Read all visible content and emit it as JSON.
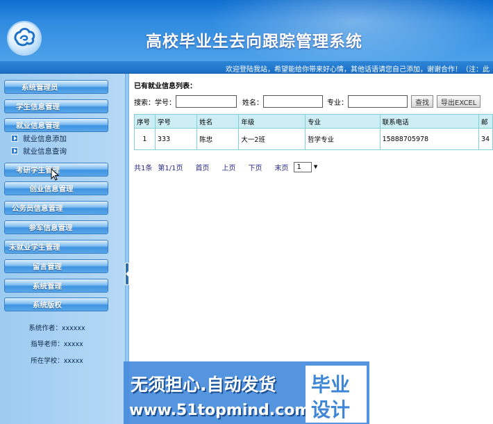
{
  "app": {
    "title": "高校毕业生去向跟踪管理系统",
    "marquee": "欢迎登陆我站，希望能给你带来好心情，其他话语请您自己添加，谢谢合作！（注：此"
  },
  "sidebar": {
    "items": [
      {
        "label": "系统管理员"
      },
      {
        "label": "学生信息管理"
      },
      {
        "label": "就业信息管理"
      },
      {
        "label": "考研学生管理"
      },
      {
        "label": "创业信息管理"
      },
      {
        "label": "公务员信息管理"
      },
      {
        "label": "参军信息管理"
      },
      {
        "label": "未就业学生管理"
      },
      {
        "label": "留言管理"
      },
      {
        "label": "系统管理"
      },
      {
        "label": "系统版权"
      }
    ],
    "subitems": [
      {
        "label": "就业信息添加"
      },
      {
        "label": "就业信息查询"
      }
    ],
    "info": {
      "author": "系统作者：xxxxxx",
      "teacher": "指导老师：xxxxx",
      "school": "所在学校：xxxxx"
    }
  },
  "main": {
    "list_title": "已有就业信息列表：",
    "search": {
      "label": "搜索：",
      "student_no_label": "学号：",
      "name_label": "姓名：",
      "major_label": "专业：",
      "student_no_value": "",
      "name_value": "",
      "major_value": "",
      "search_button": "查找",
      "export_button": "导出EXCEL"
    },
    "table": {
      "headers": [
        "序号",
        "学号",
        "姓名",
        "年级",
        "专业",
        "联系电话",
        "邮"
      ],
      "rows": [
        [
          "1",
          "333",
          "陈忠",
          "大一2班",
          "哲学专业",
          "15888705978",
          "34"
        ]
      ]
    },
    "pager": {
      "total": "共1条",
      "page": "第1/1页",
      "first": "首页",
      "prev": "上页",
      "next": "下页",
      "last": "末页",
      "current": "1"
    }
  },
  "watermark": {
    "line1": "无须担心.自动发货",
    "line2": "www.51topmind.com",
    "tag1": "毕业",
    "tag2": "设计"
  }
}
